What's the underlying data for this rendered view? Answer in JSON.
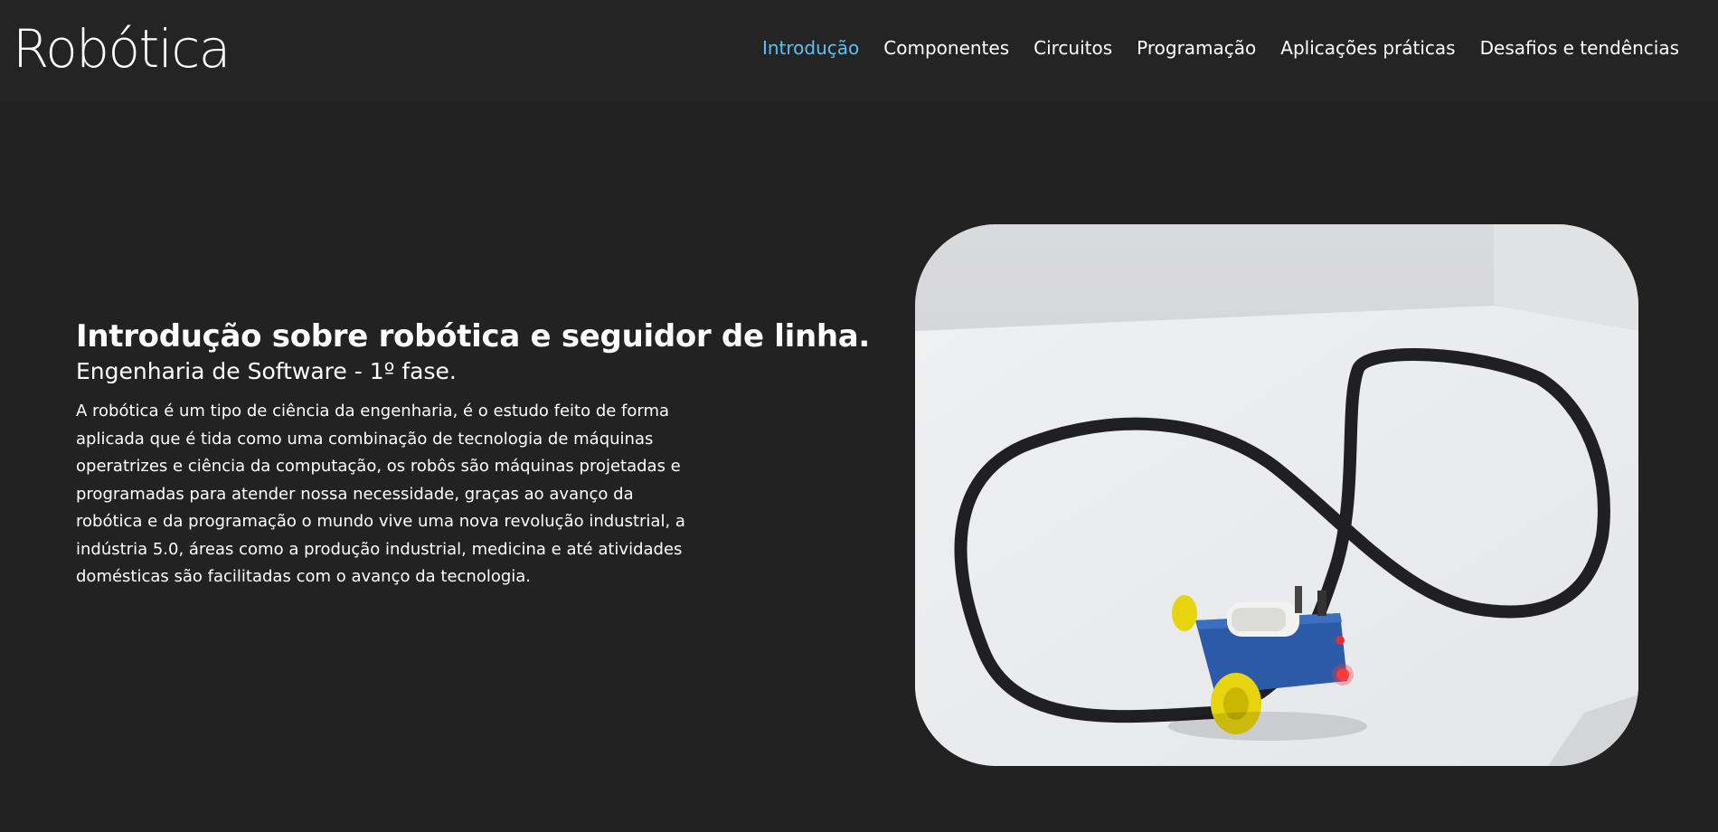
{
  "header": {
    "logo": "Robótica",
    "nav": [
      {
        "label": "Introdução",
        "active": true
      },
      {
        "label": "Componentes",
        "active": false
      },
      {
        "label": "Circuitos",
        "active": false
      },
      {
        "label": "Programação",
        "active": false
      },
      {
        "label": "Aplicações práticas",
        "active": false
      },
      {
        "label": "Desafios e tendências",
        "active": false
      }
    ]
  },
  "hero": {
    "title": "Introdução sobre robótica e seguidor de linha.",
    "subtitle": "Engenharia de Software - 1º fase.",
    "paragraph": "A robótica é um tipo de ciência da engenharia, é o estudo feito de forma aplicada que é tida como uma combinação de tecnologia de máquinas operatrizes e ciência da computação, os robôs são máquinas projetadas e programadas para atender nossa necessidade, graças ao avanço da robótica e da programação o mundo vive uma nova revolução industrial, a indústria 5.0, áreas como a produção industrial, medicina e até atividades domésticas são facilitadas com o avanço da tecnologia."
  },
  "colors": {
    "background": "#222222",
    "text": "#ffffff",
    "accent": "#5cc2f2"
  }
}
